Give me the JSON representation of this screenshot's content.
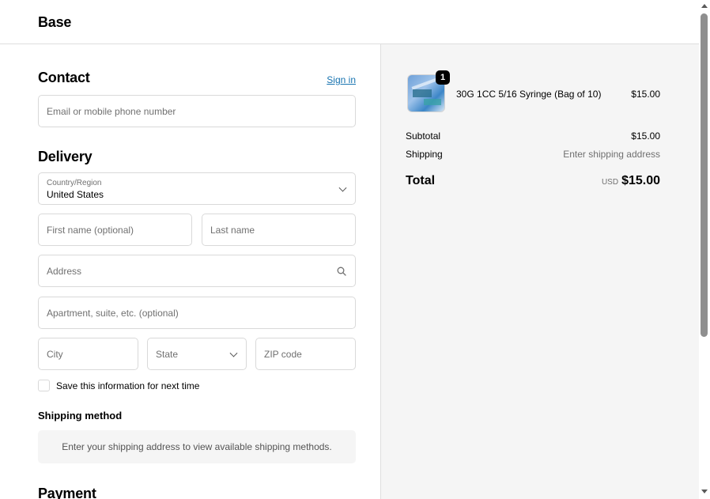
{
  "header": {
    "brand": "Base"
  },
  "contact": {
    "title": "Contact",
    "sign_in": "Sign in",
    "email_placeholder": "Email or mobile phone number"
  },
  "delivery": {
    "title": "Delivery",
    "country_label": "Country/Region",
    "country_value": "United States",
    "first_name_placeholder": "First name (optional)",
    "last_name_placeholder": "Last name",
    "address_placeholder": "Address",
    "apartment_placeholder": "Apartment, suite, etc. (optional)",
    "city_placeholder": "City",
    "state_placeholder": "State",
    "zip_placeholder": "ZIP code",
    "save_info_label": "Save this information for next time"
  },
  "shipping_method": {
    "title": "Shipping method",
    "notice": "Enter your shipping address to view available shipping methods."
  },
  "payment": {
    "title": "Payment"
  },
  "summary": {
    "item": {
      "quantity": "1",
      "name": "30G 1CC 5/16 Syringe (Bag of 10)",
      "price": "$15.00"
    },
    "subtotal_label": "Subtotal",
    "subtotal_value": "$15.00",
    "shipping_label": "Shipping",
    "shipping_value": "Enter shipping address",
    "total_label": "Total",
    "total_currency": "USD",
    "total_value": "$15.00"
  },
  "colors": {
    "link": "#1773b0",
    "summary_bg": "#f5f5f5",
    "border": "#d9d9d9"
  }
}
